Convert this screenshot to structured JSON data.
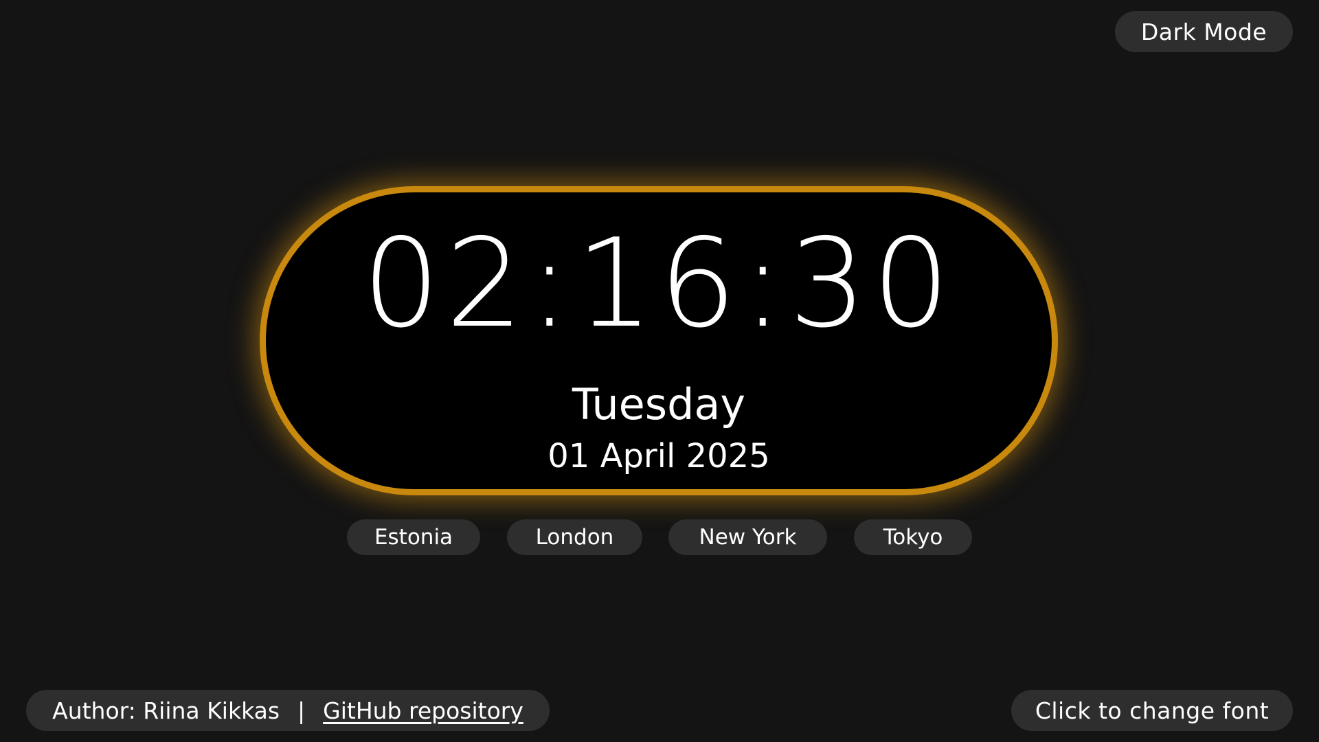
{
  "theme_toggle": {
    "label": "Dark Mode"
  },
  "clock": {
    "time": "02:16:30",
    "weekday": "Tuesday",
    "date": "01 April 2025",
    "accent_color": "#c8890e"
  },
  "timezones": [
    {
      "label": "Estonia"
    },
    {
      "label": "London"
    },
    {
      "label": "New York"
    },
    {
      "label": "Tokyo"
    }
  ],
  "footer": {
    "author": "Author: Riina Kikkas",
    "separator": "|",
    "repo_link": "GitHub repository"
  },
  "font_toggle": {
    "label": "Click to change font"
  },
  "colors": {
    "background": "#141414",
    "pill": "#2e2e2e",
    "clock_face": "#000000",
    "text": "#ffffff"
  }
}
